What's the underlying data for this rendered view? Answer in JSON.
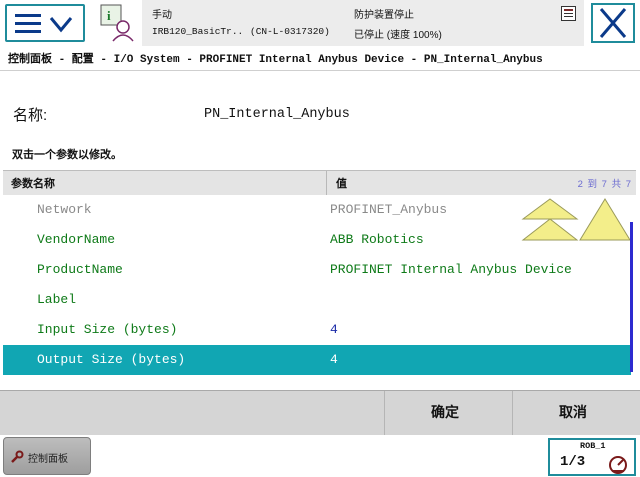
{
  "status": {
    "mode": "手动",
    "controller": "IRB120_BasicTr..",
    "system_id": "(CN-L-0317320)",
    "guard": "防护装置停止",
    "state": "已停止 (速度 100%)"
  },
  "breadcrumb": "控制面板 - 配置 - I/O System - PROFINET Internal Anybus Device - PN_Internal_Anybus",
  "instance": {
    "name_label": "名称:",
    "name_value": "PN_Internal_Anybus",
    "hint": "双击一个参数以修改。"
  },
  "table": {
    "col_name": "参数名称",
    "col_value": "值",
    "count": "2 到 7 共 7",
    "rows": [
      {
        "name": "Network",
        "value": "PROFINET_Anybus"
      },
      {
        "name": "VendorName",
        "value": "ABB Robotics"
      },
      {
        "name": "ProductName",
        "value": "PROFINET Internal Anybus Device"
      },
      {
        "name": "Label",
        "value": ""
      },
      {
        "name": "Input Size (bytes)",
        "value": "4"
      },
      {
        "name": "Output Size (bytes)",
        "value": "4"
      }
    ]
  },
  "actions": {
    "ok": "确定",
    "cancel": "取消"
  },
  "taskbar": {
    "control_panel": "控制面板"
  },
  "rob": {
    "label": "ROB_1",
    "fraction": "1/3"
  },
  "colors": {
    "accent": "#11a6b3",
    "param_text": "#0e7a18",
    "dim_text": "#8a8a8a",
    "scroll_yellow": "#f3ee8a"
  }
}
